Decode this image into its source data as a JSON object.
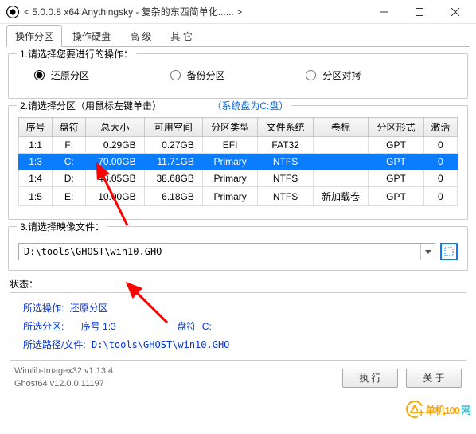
{
  "window": {
    "title": "< 5.0.0.8 x64 Anythingsky - 复杂的东西简单化...... >"
  },
  "tabs": [
    {
      "label": "操作分区",
      "active": true
    },
    {
      "label": "操作硬盘",
      "active": false
    },
    {
      "label": "高 级",
      "active": false
    },
    {
      "label": "其 它",
      "active": false
    }
  ],
  "group1": {
    "legend": "1.请选择您要进行的操作：",
    "options": [
      {
        "label": "还原分区",
        "checked": true
      },
      {
        "label": "备份分区",
        "checked": false
      },
      {
        "label": "分区对拷",
        "checked": false
      }
    ]
  },
  "group2": {
    "legend": "2.请选择分区（用鼠标左键单击）",
    "syshint": "（系统盘为C:盘）",
    "columns": [
      "序号",
      "盘符",
      "总大小",
      "可用空间",
      "分区类型",
      "文件系统",
      "卷标",
      "分区形式",
      "激活"
    ],
    "rows": [
      {
        "seq": "1:1",
        "drv": "F:",
        "size": "0.29GB",
        "free": "0.27GB",
        "ptype": "EFI",
        "fs": "FAT32",
        "vol": "",
        "pform": "GPT",
        "act": "0",
        "sel": false
      },
      {
        "seq": "1:3",
        "drv": "C:",
        "size": "70.00GB",
        "free": "11.71GB",
        "ptype": "Primary",
        "fs": "NTFS",
        "vol": "",
        "pform": "GPT",
        "act": "0",
        "sel": true
      },
      {
        "seq": "1:4",
        "drv": "D:",
        "size": "48.05GB",
        "free": "38.68GB",
        "ptype": "Primary",
        "fs": "NTFS",
        "vol": "",
        "pform": "GPT",
        "act": "0",
        "sel": false
      },
      {
        "seq": "1:5",
        "drv": "E:",
        "size": "10.00GB",
        "free": "6.18GB",
        "ptype": "Primary",
        "fs": "NTFS",
        "vol": "新加载卷",
        "pform": "GPT",
        "act": "0",
        "sel": false
      }
    ]
  },
  "group3": {
    "legend": "3.请选择映像文件：",
    "path": "D:\\tools\\GHOST\\win10.GHO"
  },
  "status": {
    "label": "状态：",
    "op_lbl": "所选操作:",
    "op_val": "还原分区",
    "part_seq_lbl": "所选分区:",
    "part_seq_prefix": "序号",
    "part_seq_val": "1:3",
    "part_drv_lbl": "盘符",
    "part_drv_val": "C:",
    "path_lbl": "所选路径/文件:",
    "path_val": "D:\\tools\\GHOST\\win10.GHO"
  },
  "footer": {
    "ver1": "Wimlib-Imagex32 v1.13.4",
    "ver2": "Ghost64 v12.0.0.11197",
    "exec": "执 行",
    "about": "关 于"
  },
  "watermark": {
    "t1": "单机100",
    "t2": "网"
  }
}
